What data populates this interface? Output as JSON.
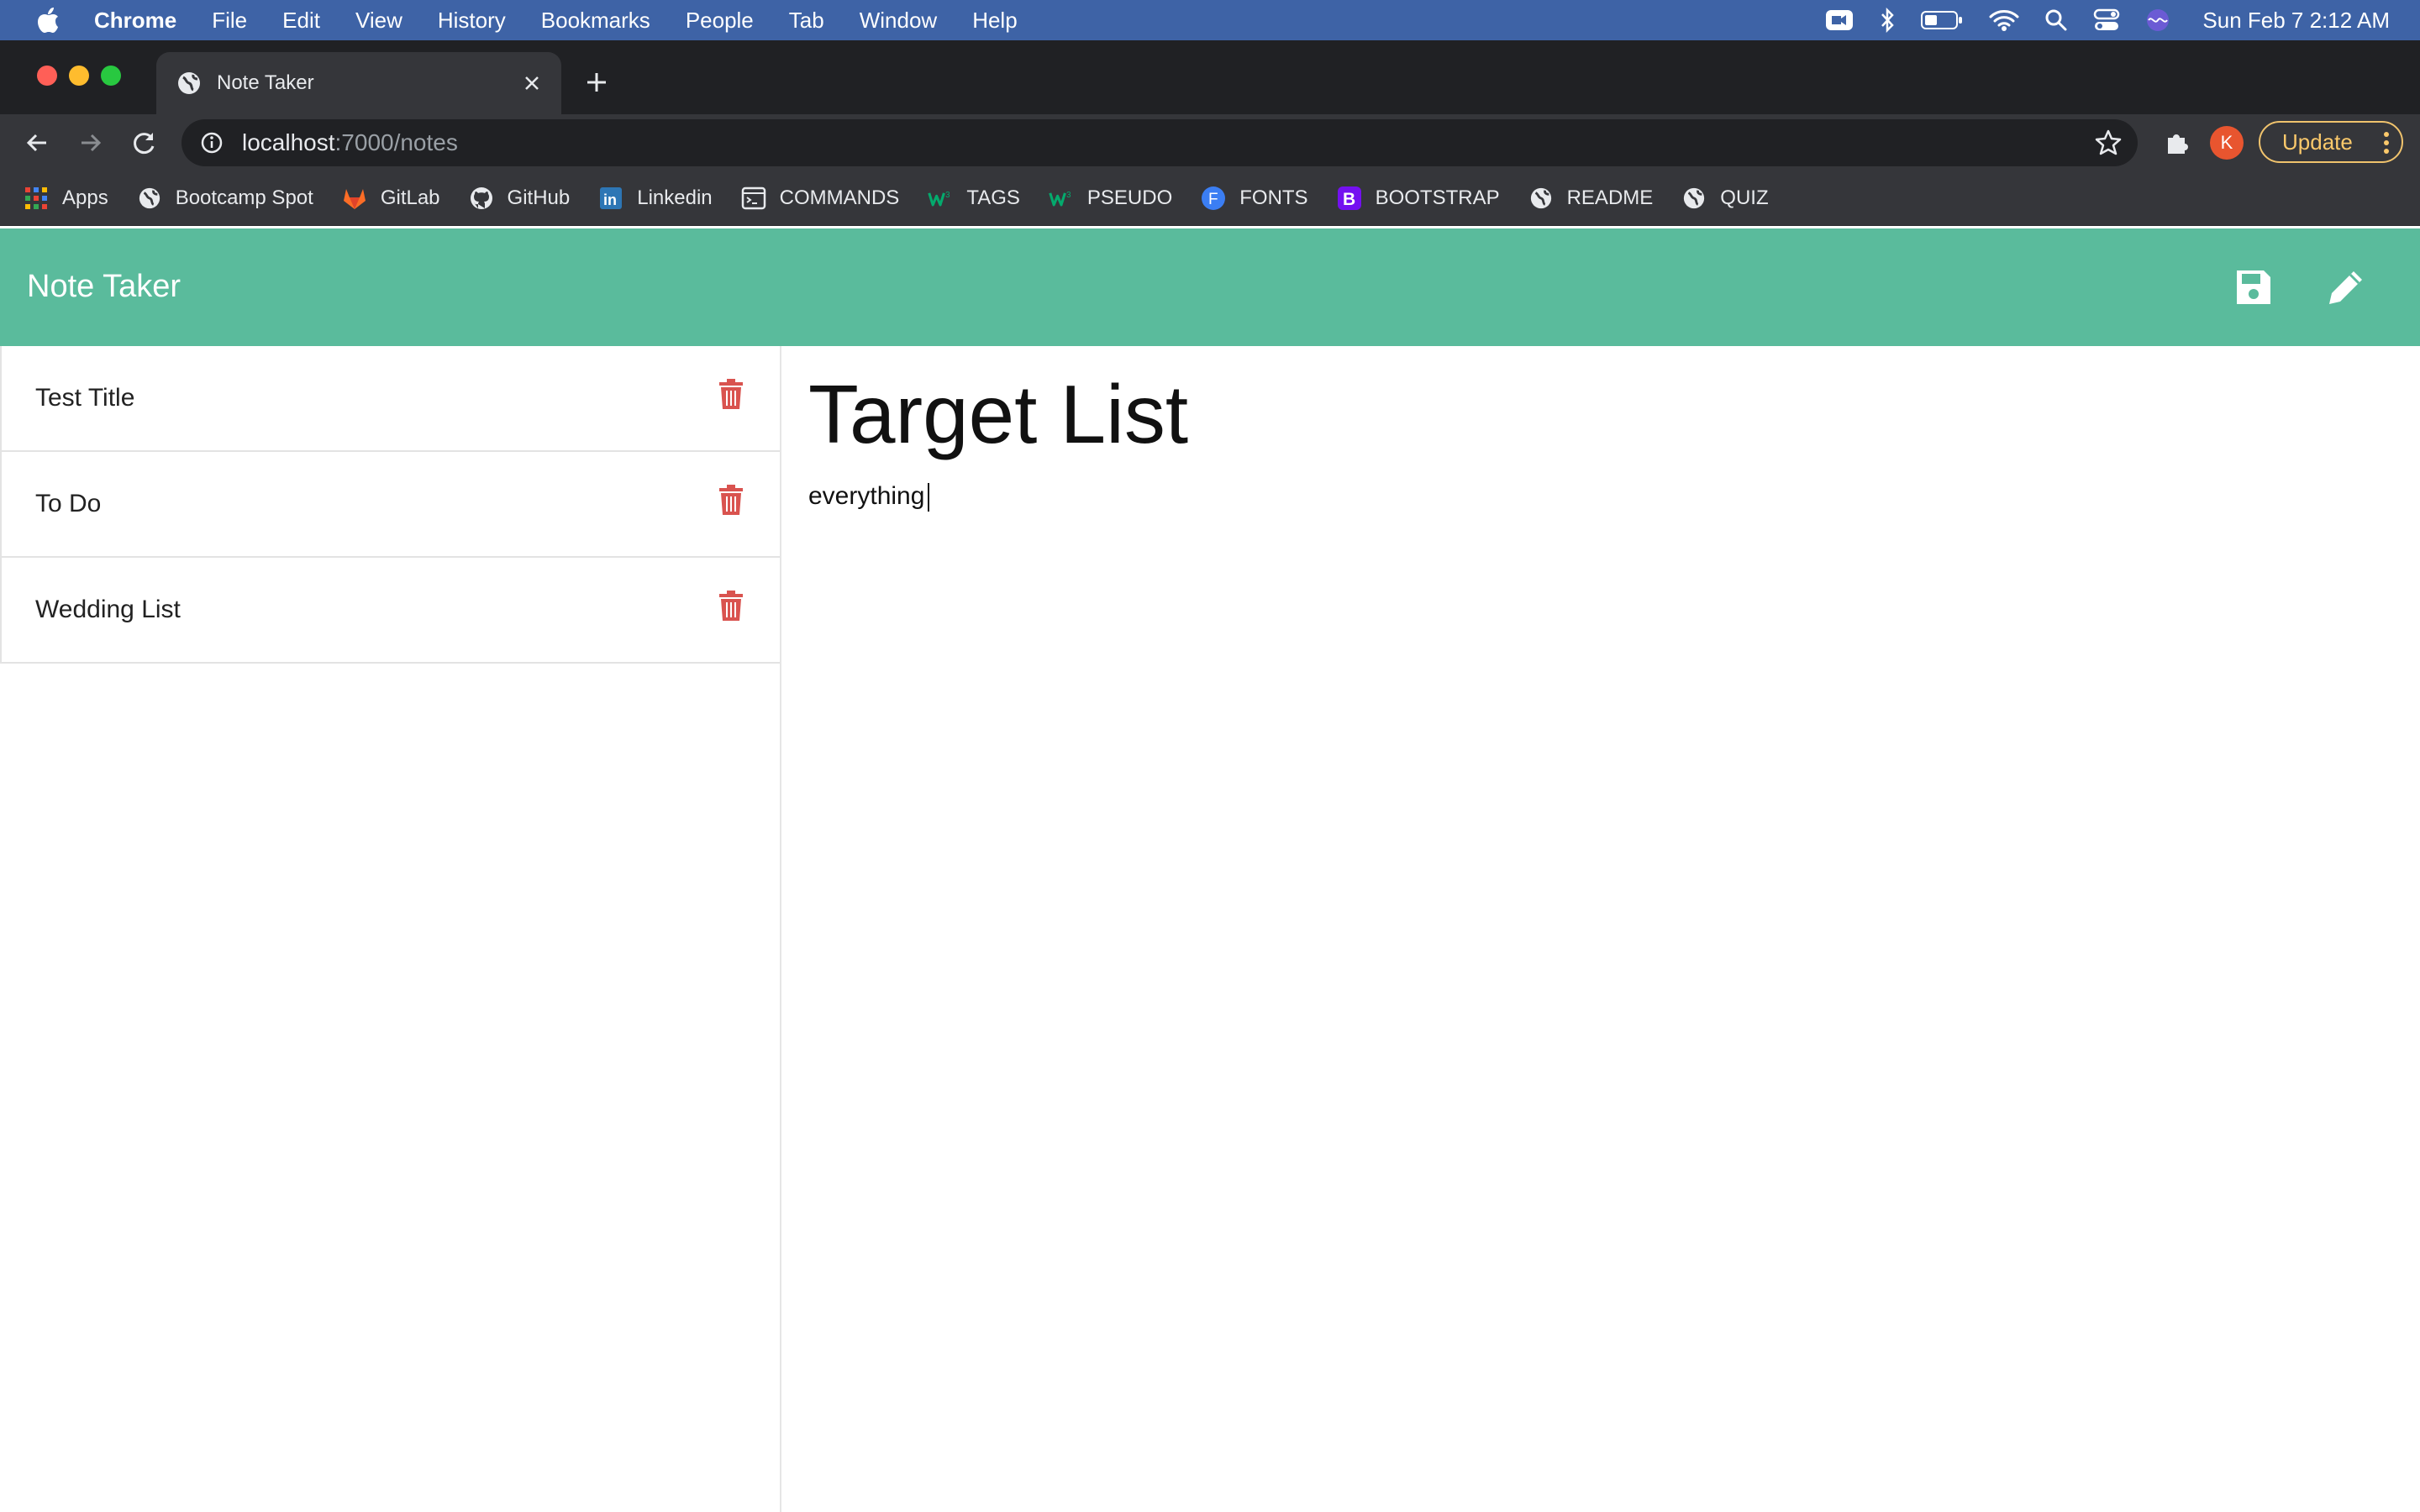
{
  "menubar": {
    "app_name": "Chrome",
    "items": [
      "File",
      "Edit",
      "View",
      "History",
      "Bookmarks",
      "People",
      "Tab",
      "Window",
      "Help"
    ],
    "clock": "Sun Feb 7  2:12 AM",
    "status_icons": [
      "zoom-icon",
      "bluetooth-icon",
      "battery-icon",
      "wifi-icon",
      "spotlight-icon",
      "control-center-icon",
      "siri-icon"
    ]
  },
  "browser": {
    "tab_title": "Note Taker",
    "url_host": "localhost",
    "url_path": ":7000/notes",
    "profile_initial": "K",
    "update_label": "Update",
    "bookmarks": [
      {
        "label": "Apps",
        "icon": "apps-grid-icon"
      },
      {
        "label": "Bootcamp Spot",
        "icon": "globe-icon"
      },
      {
        "label": "GitLab",
        "icon": "gitlab-icon"
      },
      {
        "label": "GitHub",
        "icon": "github-icon"
      },
      {
        "label": "Linkedin",
        "icon": "linkedin-icon"
      },
      {
        "label": "COMMANDS",
        "icon": "terminal-icon"
      },
      {
        "label": "TAGS",
        "icon": "w3-icon"
      },
      {
        "label": "PSEUDO",
        "icon": "w3-icon"
      },
      {
        "label": "FONTS",
        "icon": "fonts-f-icon"
      },
      {
        "label": "BOOTSTRAP",
        "icon": "bootstrap-icon"
      },
      {
        "label": "README",
        "icon": "globe-icon"
      },
      {
        "label": "QUIZ",
        "icon": "globe-icon"
      }
    ]
  },
  "app": {
    "brand": "Note Taker",
    "accent_color": "#5abb9c",
    "delete_color": "#d9534f",
    "notes": [
      {
        "title": "Test Title"
      },
      {
        "title": "To Do"
      },
      {
        "title": "Wedding List"
      }
    ],
    "active_note": {
      "title": "Target List",
      "body": "everything"
    }
  }
}
